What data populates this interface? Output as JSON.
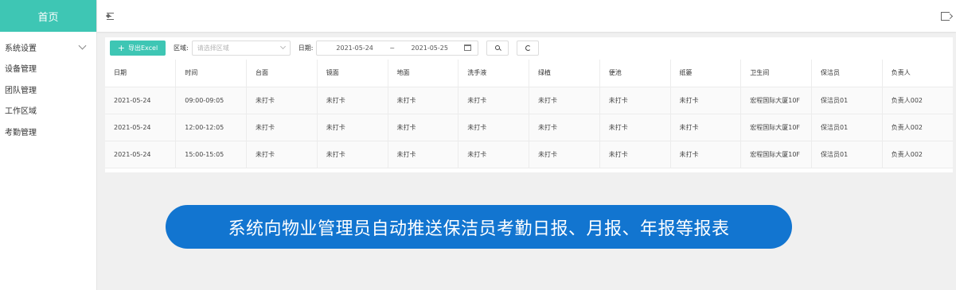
{
  "sidebar": {
    "brand": "首页",
    "items": [
      {
        "label": "系统设置"
      },
      {
        "label": "设备管理"
      },
      {
        "label": "团队管理"
      },
      {
        "label": "工作区域"
      },
      {
        "label": "考勤管理"
      }
    ]
  },
  "toolbar": {
    "export_label": "导出Excel",
    "region_label": "区域:",
    "region_placeholder": "请选择区域",
    "date_label": "日期:",
    "date_start": "2021-05-24",
    "date_sep": "~",
    "date_end": "2021-05-25"
  },
  "table": {
    "headers": [
      "日期",
      "时间",
      "台面",
      "镜面",
      "地面",
      "洗手液",
      "绿植",
      "便池",
      "纸篓",
      "卫生间",
      "保洁员",
      "负责人"
    ],
    "rows": [
      [
        "2021-05-24",
        "09:00-09:05",
        "未打卡",
        "未打卡",
        "未打卡",
        "未打卡",
        "未打卡",
        "未打卡",
        "未打卡",
        "宏程国际大厦10F",
        "保洁员01",
        "负责人002"
      ],
      [
        "2021-05-24",
        "12:00-12:05",
        "未打卡",
        "未打卡",
        "未打卡",
        "未打卡",
        "未打卡",
        "未打卡",
        "未打卡",
        "宏程国际大厦10F",
        "保洁员01",
        "负责人002"
      ],
      [
        "2021-05-24",
        "15:00-15:05",
        "未打卡",
        "未打卡",
        "未打卡",
        "未打卡",
        "未打卡",
        "未打卡",
        "未打卡",
        "宏程国际大厦10F",
        "保洁员01",
        "负责人002"
      ]
    ]
  },
  "banner": {
    "text": "系统向物业管理员自动推送保洁员考勤日报、月报、年报等报表"
  },
  "colors": {
    "brand": "#3ec6b4",
    "banner": "#1275d0"
  }
}
